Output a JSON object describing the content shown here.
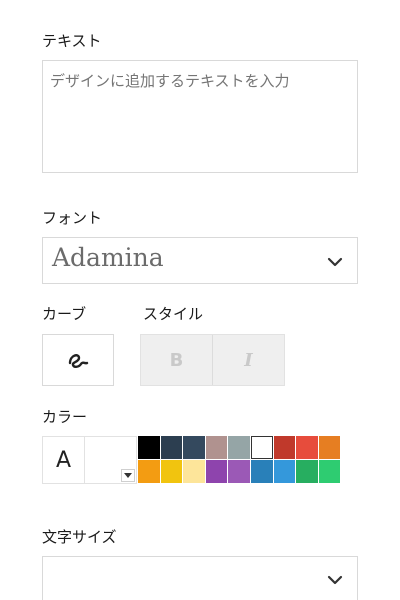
{
  "text_section": {
    "label": "テキスト",
    "placeholder": "デザインに追加するテキストを入力",
    "value": ""
  },
  "font_section": {
    "label": "フォント",
    "selected": "Adamina"
  },
  "curve_section": {
    "label": "カーブ"
  },
  "style_section": {
    "label": "スタイル",
    "bold_label": "B",
    "italic_label": "I"
  },
  "color_section": {
    "label": "カラー",
    "preview_letter": "A",
    "selected_color": "#ffffff",
    "swatches": [
      "#000000",
      "#2c3e50",
      "#34495e",
      "#b0928f",
      "#95a5a6",
      "#ffffff",
      "#c0392b",
      "#e74c3c",
      "#e67e22",
      "#f39c12",
      "#f1c40f",
      "#fde59a",
      "#8e44ad",
      "#9b59b6",
      "#2980b9",
      "#3498db",
      "#27ae60",
      "#2ecc71"
    ]
  },
  "size_section": {
    "label": "文字サイズ",
    "selected": ""
  }
}
